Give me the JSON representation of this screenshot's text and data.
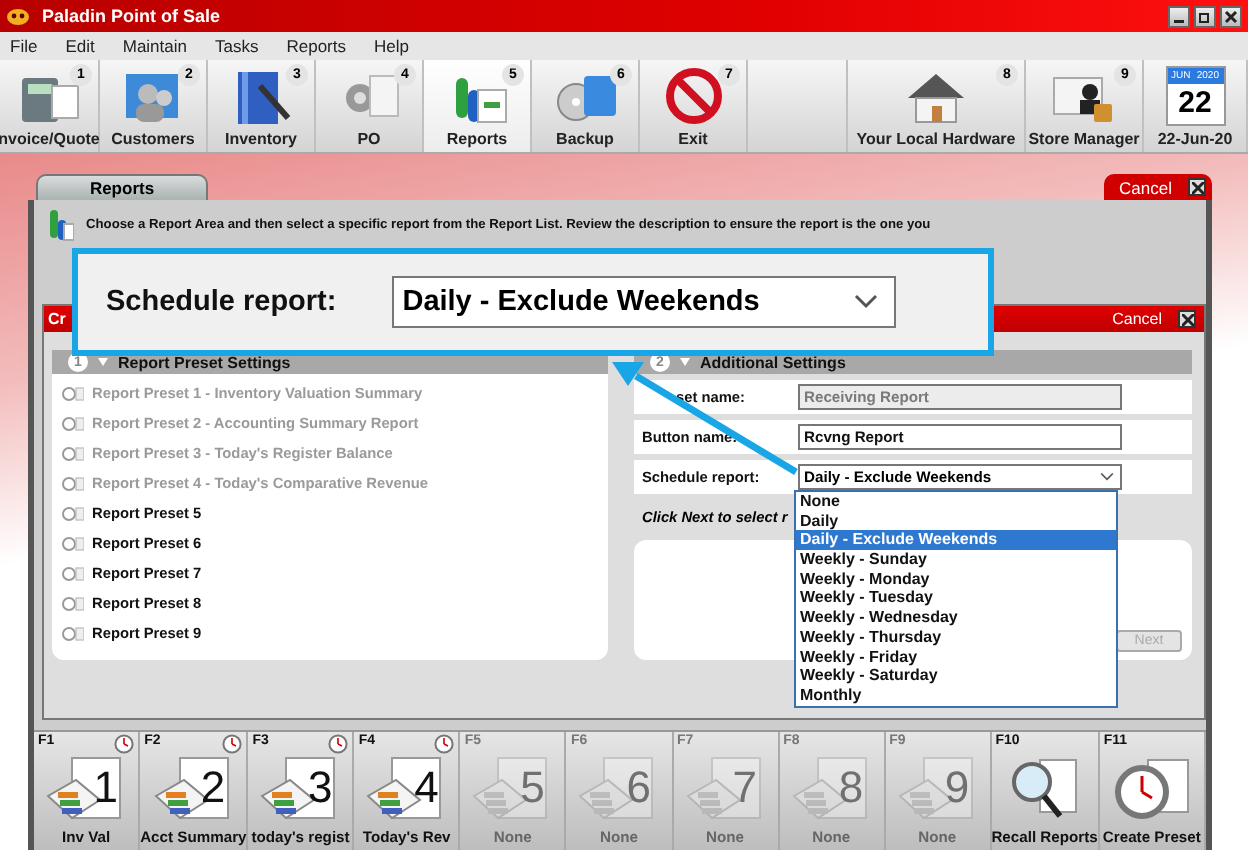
{
  "window": {
    "title": "Paladin Point of Sale"
  },
  "menu": [
    "File",
    "Edit",
    "Maintain",
    "Tasks",
    "Reports",
    "Help"
  ],
  "toolbar": [
    {
      "kind": "button",
      "label": "nvoice/Quote",
      "number": "1",
      "selected": false
    },
    {
      "kind": "button",
      "label": "Customers",
      "number": "2",
      "selected": false
    },
    {
      "kind": "button",
      "label": "Inventory",
      "number": "3",
      "selected": false
    },
    {
      "kind": "button",
      "label": "PO",
      "number": "4",
      "selected": false
    },
    {
      "kind": "button",
      "label": "Reports",
      "number": "5",
      "selected": true
    },
    {
      "kind": "button",
      "label": "Backup",
      "number": "6",
      "selected": false
    },
    {
      "kind": "button",
      "label": "Exit",
      "number": "7",
      "selected": false
    },
    {
      "kind": "empty"
    },
    {
      "kind": "button",
      "label": "Your Local Hardware",
      "number": "8",
      "selected": false
    },
    {
      "kind": "button",
      "label": "Store Manager",
      "number": "9",
      "selected": false
    },
    {
      "kind": "date",
      "label": "22-Jun-20",
      "month": "JUN",
      "year": "2020",
      "day": "22"
    }
  ],
  "tab": {
    "label": "Reports",
    "selected": true
  },
  "cancel_tab": {
    "label": "Cancel"
  },
  "description": "Choose a Report Area and then select a specific report from the Report List. Review the description to ensure the report is the one you",
  "callout": {
    "label": "Schedule report:",
    "value": "Daily - Exclude Weekends"
  },
  "dialog": {
    "title": "Cr",
    "cancel": "Cancel",
    "sections": [
      {
        "number": "1",
        "title": "Report Preset Settings"
      },
      {
        "number": "2",
        "title": "Additional Settings"
      }
    ],
    "presets": [
      {
        "label": "Report Preset 1 - Inventory Valuation Summary",
        "disabled": true
      },
      {
        "label": "Report Preset 2 - Accounting Summary Report",
        "disabled": true
      },
      {
        "label": "Report Preset 3 - Today's Register Balance",
        "disabled": true
      },
      {
        "label": "Report Preset 4 - Today's Comparative Revenue",
        "disabled": true
      },
      {
        "label": "Report Preset 5",
        "disabled": false
      },
      {
        "label": "Report Preset 6",
        "disabled": false
      },
      {
        "label": "Report Preset 7",
        "disabled": false
      },
      {
        "label": "Report Preset 8",
        "disabled": false
      },
      {
        "label": "Report Preset 9",
        "disabled": false
      }
    ],
    "fields": [
      {
        "kind": "text",
        "label": "set name:",
        "value": "Receiving Report",
        "disabled": true
      },
      {
        "kind": "text",
        "label": "Button name:",
        "value": "Rcvng Report",
        "disabled": false
      },
      {
        "kind": "select",
        "label": "Schedule report:",
        "value": "Daily - Exclude Weekends",
        "expanded": true,
        "options": [
          {
            "label": "None",
            "selected": false
          },
          {
            "label": "Daily",
            "selected": false
          },
          {
            "label": "Daily - Exclude Weekends",
            "selected": true
          },
          {
            "label": "Weekly - Sunday",
            "selected": false
          },
          {
            "label": "Weekly - Monday",
            "selected": false
          },
          {
            "label": "Weekly - Tuesday",
            "selected": false
          },
          {
            "label": "Weekly - Wednesday",
            "selected": false
          },
          {
            "label": "Weekly - Thursday",
            "selected": false
          },
          {
            "label": "Weekly - Friday",
            "selected": false
          },
          {
            "label": "Weekly - Saturday",
            "selected": false
          },
          {
            "label": "Monthly",
            "selected": false
          }
        ]
      }
    ],
    "hint": "Click Next to select r",
    "next_button": {
      "label": "Next",
      "disabled": true
    }
  },
  "fkeys": [
    {
      "kind": "preset",
      "key": "F1",
      "number": "1",
      "label": "Inv Val",
      "scheduled": true,
      "disabled": false
    },
    {
      "kind": "preset",
      "key": "F2",
      "number": "2",
      "label": "Acct Summary",
      "scheduled": true,
      "disabled": false
    },
    {
      "kind": "preset",
      "key": "F3",
      "number": "3",
      "label": "today's regist",
      "scheduled": true,
      "disabled": false
    },
    {
      "kind": "preset",
      "key": "F4",
      "number": "4",
      "label": "Today's Rev",
      "scheduled": true,
      "disabled": false
    },
    {
      "kind": "preset",
      "key": "F5",
      "number": "5",
      "label": "None",
      "scheduled": false,
      "disabled": true
    },
    {
      "kind": "preset",
      "key": "F6",
      "number": "6",
      "label": "None",
      "scheduled": false,
      "disabled": true
    },
    {
      "kind": "preset",
      "key": "F7",
      "number": "7",
      "label": "None",
      "scheduled": false,
      "disabled": true
    },
    {
      "kind": "preset",
      "key": "F8",
      "number": "8",
      "label": "None",
      "scheduled": false,
      "disabled": true
    },
    {
      "kind": "preset",
      "key": "F9",
      "number": "9",
      "label": "None",
      "scheduled": false,
      "disabled": true
    },
    {
      "kind": "recall",
      "key": "F10",
      "label": "Recall Reports"
    },
    {
      "kind": "create",
      "key": "F11",
      "label": "Create Preset"
    }
  ]
}
